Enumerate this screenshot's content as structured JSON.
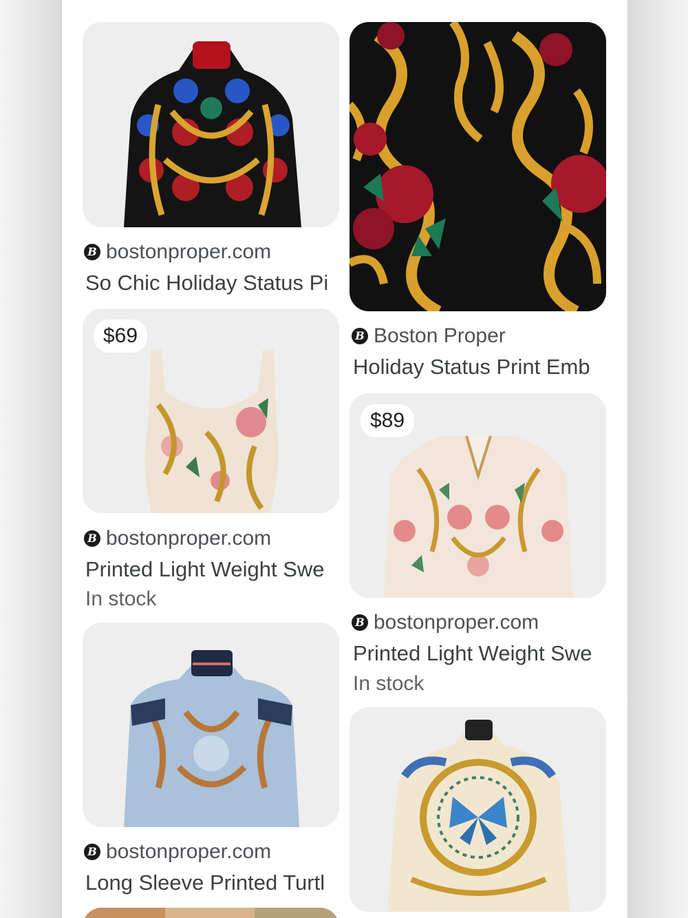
{
  "results": [
    {
      "price": "",
      "source_icon": "boston-proper-logo",
      "source": "bostonproper.com",
      "title": "So Chic Holiday Status Pi",
      "stock": ""
    },
    {
      "price": "",
      "source_icon": "boston-proper-logo",
      "source": "Boston Proper",
      "title": "Holiday Status Print Emb",
      "stock": ""
    },
    {
      "price": "$69",
      "source_icon": "boston-proper-logo",
      "source": "bostonproper.com",
      "title": "Printed Light Weight Swe",
      "stock": "In stock"
    },
    {
      "price": "$89",
      "source_icon": "boston-proper-logo",
      "source": "bostonproper.com",
      "title": "Printed Light Weight Swe",
      "stock": "In stock"
    },
    {
      "price": "",
      "source_icon": "boston-proper-logo",
      "source": "bostonproper.com",
      "title": "Long Sleeve Printed Turtl",
      "stock": ""
    },
    {
      "price": "",
      "source_icon": "boston-proper-logo",
      "source": "",
      "title": "",
      "stock": ""
    }
  ],
  "source_logo_letter": "B",
  "colors": {
    "page_bg": "#ffffff",
    "text_title": "#3c4043",
    "text_source": "#4d5156",
    "thumb_bg": "#eeeeee"
  }
}
